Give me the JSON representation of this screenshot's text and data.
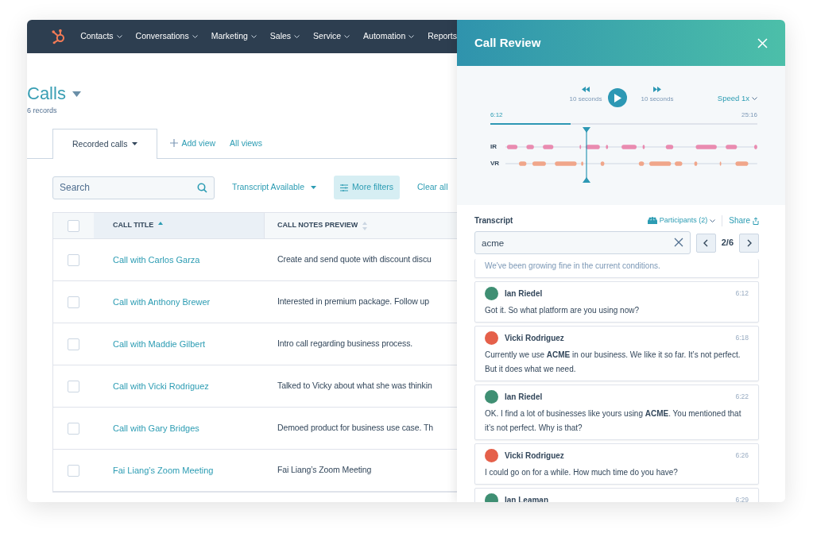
{
  "nav": {
    "items": [
      "Contacts",
      "Conversations",
      "Marketing",
      "Sales",
      "Service",
      "Automation",
      "Reports"
    ]
  },
  "page": {
    "title": "Calls",
    "count": "6 records"
  },
  "views": {
    "tabs": [
      {
        "label": "Recorded calls",
        "selected": true
      }
    ],
    "add_view": "Add view",
    "all_views": "All views"
  },
  "filters": {
    "search": {
      "placeholder": "Search"
    },
    "transcript_filter": "Transcript Available",
    "more_filters": "More filters",
    "clear": "Clear all"
  },
  "table": {
    "select_all_checked": false,
    "columns": [
      {
        "label": "CALL TITLE",
        "sorted": true
      },
      {
        "label": "CALL NOTES PREVIEW",
        "sorted": false
      }
    ],
    "rows": [
      {
        "title": "Call with Carlos Garza",
        "notes": "Create and send quote with discount discu",
        "checked": false
      },
      {
        "title": "Call with Anthony Brewer",
        "notes": "Interested in premium package. Follow up",
        "checked": false
      },
      {
        "title": "Call with Maddie Gilbert",
        "notes": "Intro call regarding business process.",
        "checked": false
      },
      {
        "title": "Call with Vicki Rodriguez",
        "notes": "Talked to Vicky about what she was thinkin",
        "checked": false
      },
      {
        "title": "Call with Gary Bridges",
        "notes": "Demoed product for business use case. Th",
        "checked": false
      },
      {
        "title": "Fai Liang’s Zoom Meeting",
        "notes": "Fai Liang’s Zoom Meeting",
        "checked": false
      }
    ]
  },
  "review": {
    "title": "Call Review",
    "back_label": "10 seconds",
    "forward_label": "10 seconds",
    "speed": "Speed 1x",
    "current_time": "6:12",
    "total_time": "25:16",
    "level": 0.3,
    "tracks": [
      {
        "label": "IR",
        "color": "#e98bb0"
      },
      {
        "label": "VR",
        "color": "#f0a68a"
      }
    ]
  },
  "transcript": {
    "heading": "Transcript",
    "participants": "Participants (2)",
    "share": "Share",
    "search": {
      "value": "acme"
    },
    "match": "2/6",
    "messages": [
      {
        "kind": "fragment",
        "text": "We've been growing fine in the current conditions."
      },
      {
        "kind": "message",
        "speaker": "Ian Riedel",
        "time": "6:12",
        "color": "#3f8f73",
        "text": "Got it. So what platform are you using now?"
      },
      {
        "kind": "message",
        "speaker": "Vicki Rodriguez",
        "time": "6:18",
        "color": "#e5604a",
        "text": "Currently we use **ACME** in our business. We like it so far. It’s not perfect. But it does what we need."
      },
      {
        "kind": "message",
        "speaker": "Ian Riedel",
        "time": "6:22",
        "color": "#3f8f73",
        "text": "OK. I find a lot of businesses like yours using **ACME**. You mentioned that it’s not perfect. Why is that?"
      },
      {
        "kind": "message",
        "speaker": "Vicki Rodriguez",
        "time": "6:26",
        "color": "#e5604a",
        "text": "I could go on for a while. How much time do you have?"
      },
      {
        "kind": "message",
        "speaker": "Ian Leaman",
        "time": "6:29",
        "color": "#3f8f73"
      }
    ]
  }
}
